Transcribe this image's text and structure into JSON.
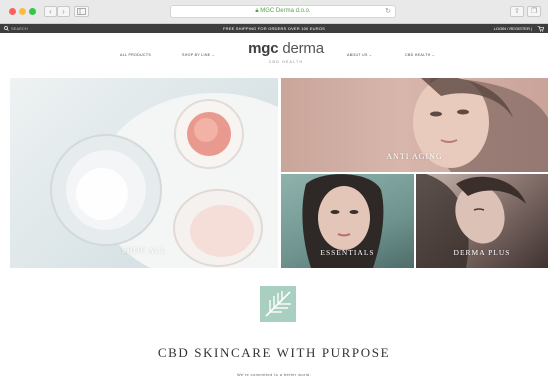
{
  "browser": {
    "url": "MGC Derma d.o.o.",
    "back_icon": "chevron-left-icon",
    "forward_icon": "chevron-right-icon",
    "sidebar_icon": "sidebar-icon",
    "reload_icon": "reload-icon",
    "share_icon": "share-icon",
    "tabs_icon": "tabs-icon"
  },
  "promo": {
    "search_placeholder": "SEARCH",
    "text": "FREE SHIPPING FOR ORDERS OVER 100 EUROS",
    "login": "LOGIN / REGISTER |",
    "cart_icon": "cart-icon"
  },
  "nav": {
    "all_products": "ALL PRODUCTS",
    "shop_by_line": "SHOP BY LINE ⌄",
    "about_us": "ABOUT US ⌄",
    "cbd_health": "CBD HEALTH ⌄"
  },
  "logo": {
    "brand_bold": "mgc",
    "brand_light": " derma",
    "sub": "CBD HEALTH"
  },
  "hero": {
    "shop_all": "SHOP ALL",
    "anti_aging": "ANTI AGING",
    "essentials": "ESSENTIALS",
    "derma_plus": "DERMA PLUS"
  },
  "section": {
    "tagline": "CBD SKINCARE WITH PURPOSE",
    "subline": "We're committed to a better world."
  },
  "colors": {
    "accent_green": "#a8cfc0",
    "promo_bar": "#3d3d3d"
  }
}
